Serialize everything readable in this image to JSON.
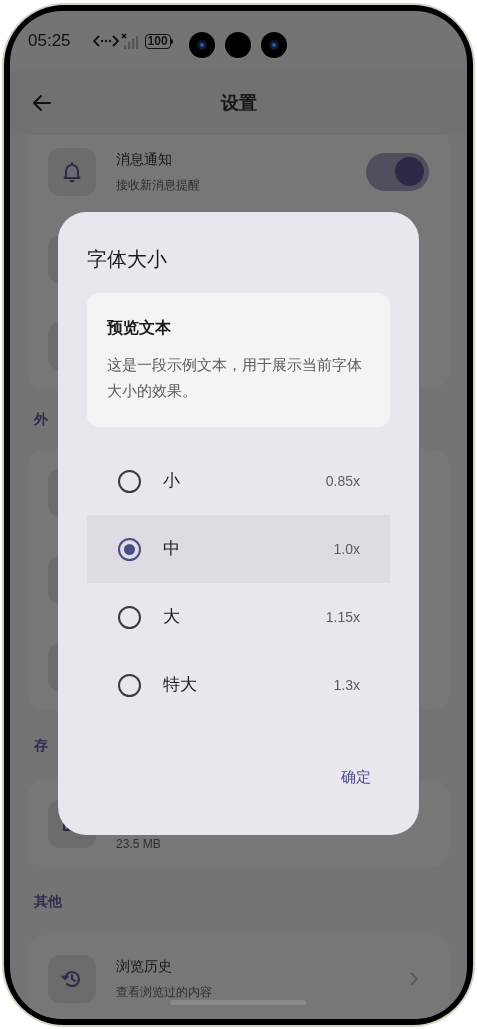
{
  "status_bar": {
    "time": "05:25",
    "battery": "100"
  },
  "header": {
    "title": "设置"
  },
  "sections": [
    {
      "items": [
        {
          "kind": "toggle",
          "title": "消息通知",
          "subtitle": "接收新消息提醒",
          "on": true
        },
        {
          "kind": "covered"
        },
        {
          "kind": "covered"
        }
      ]
    },
    {
      "title": "外",
      "items": [
        {
          "kind": "covered"
        },
        {
          "kind": "covered"
        },
        {
          "kind": "covered"
        }
      ]
    },
    {
      "title": "存",
      "items": [
        {
          "kind": "info",
          "subtitle": "23.5 MB"
        }
      ]
    },
    {
      "title": "其他",
      "items": [
        {
          "kind": "link",
          "title": "浏览历史",
          "subtitle": "查看浏览过的内容"
        }
      ]
    }
  ],
  "dialog": {
    "title": "字体大小",
    "preview": {
      "title": "预览文本",
      "text": "这是一段示例文本，用于展示当前字体大小的效果。"
    },
    "options": [
      {
        "label": "小",
        "value": "0.85x",
        "selected": false
      },
      {
        "label": "中",
        "value": "1.0x",
        "selected": true
      },
      {
        "label": "大",
        "value": "1.15x",
        "selected": false
      },
      {
        "label": "特大",
        "value": "1.3x",
        "selected": false
      }
    ],
    "confirm": "确定"
  }
}
